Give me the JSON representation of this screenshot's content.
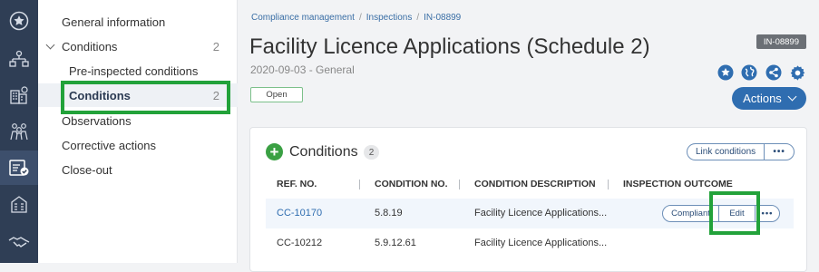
{
  "rail": {
    "items": [
      {
        "name": "favorites-star-icon",
        "icon": "star-circle"
      },
      {
        "name": "people-hierarchy-icon",
        "icon": "people-tree"
      },
      {
        "name": "buildings-tree-icon",
        "icon": "building-tree"
      },
      {
        "name": "group-people-icon",
        "icon": "group"
      },
      {
        "name": "inspection-checklist-icon",
        "icon": "checklist"
      },
      {
        "name": "facility-building-icon",
        "icon": "building"
      },
      {
        "name": "handshake-icon",
        "icon": "handshake"
      }
    ]
  },
  "sidenav": {
    "general": "General information",
    "conditions_group": {
      "label": "Conditions",
      "count": "2"
    },
    "pre_inspected": "Pre-inspected conditions",
    "conditions": {
      "label": "Conditions",
      "count": "2"
    },
    "observations": "Observations",
    "corrective": "Corrective actions",
    "closeout": "Close-out"
  },
  "breadcrumb": {
    "item1": "Compliance management",
    "sep": "/",
    "item2": "Inspections",
    "item3": "IN-08899"
  },
  "header": {
    "title": "Facility Licence Applications (Schedule 2)",
    "subtitle": "2020-09-03 - General",
    "status": "Open",
    "id": "IN-08899",
    "actions": "Actions"
  },
  "conditions_card": {
    "title": "Conditions",
    "count": "2",
    "link_button": "Link conditions",
    "more": "•••",
    "columns": {
      "ref": "REF. NO.",
      "condition_no": "CONDITION NO.",
      "description": "CONDITION DESCRIPTION",
      "outcome": "INSPECTION OUTCOME"
    },
    "rows": [
      {
        "ref": "CC-10170",
        "condition_no": "5.8.19",
        "description": "Facility Licence Applications...",
        "compliant": "Compliant",
        "edit": "Edit",
        "more": "•••"
      },
      {
        "ref": "CC-10212",
        "condition_no": "5.9.12.61",
        "description": "Facility Licence Applications..."
      }
    ]
  },
  "colors": {
    "rail_bg": "#2f3e55",
    "primary": "#2f6db0",
    "highlight": "#22a23a",
    "add_green": "#3aa043"
  }
}
